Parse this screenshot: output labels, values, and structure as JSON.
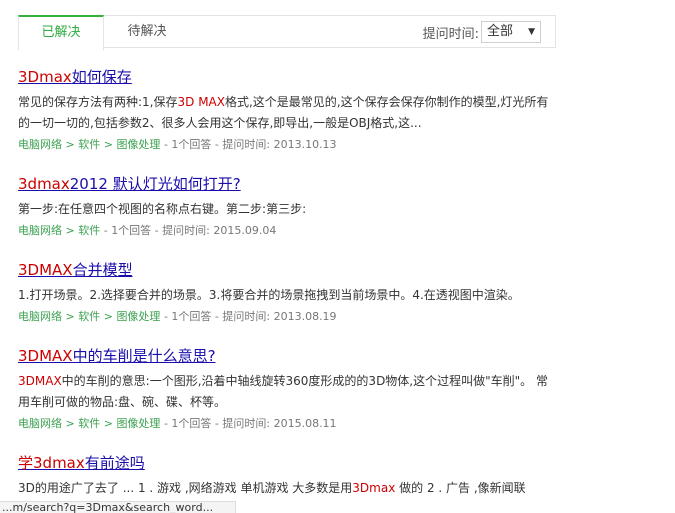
{
  "tabs": {
    "solved": "已解决",
    "pending": "待解决"
  },
  "time_filter": {
    "label": "提问时间:",
    "selected": "全部"
  },
  "results": [
    {
      "title_hl": "3Dmax",
      "title_rest": "如何保存",
      "snippet_pre": "常见的保存方法有两种:1,保存",
      "snippet_hl": "3D MAX",
      "snippet_post": "格式,这个是最常见的,这个保存会保存你制作的模型,灯光所有的一切一切的,包括参数2、很多人会用这个保存,即导出,一般是OBJ格式,这...",
      "cat1": "电脑网络",
      "cat2": "软件",
      "cat3": "图像处理",
      "answers": "1个回答",
      "time": "提问时间: 2013.10.13"
    },
    {
      "title_hl": "3dmax",
      "title_rest": "2012 默认灯光如何打开?",
      "snippet_pre": "第一步:在任意四个视图的名称点右键。第二步:第三步:",
      "snippet_hl": "",
      "snippet_post": "",
      "cat1": "电脑网络",
      "cat2": "软件",
      "cat3": "",
      "answers": "1个回答",
      "time": "提问时间: 2015.09.04"
    },
    {
      "title_hl": "3DMAX",
      "title_rest": "合并模型",
      "snippet_pre": "1.打开场景。2.选择要合并的场景。3.将要合并的场景拖拽到当前场景中。4.在透视图中渲染。",
      "snippet_hl": "",
      "snippet_post": "",
      "cat1": "电脑网络",
      "cat2": "软件",
      "cat3": "图像处理",
      "answers": "1个回答",
      "time": "提问时间: 2013.08.19"
    },
    {
      "title_hl": "3DMAX",
      "title_rest": "中的车削是什么意思?",
      "snippet_pre": "",
      "snippet_hl": "3DMAX",
      "snippet_post": "中的车削的意思:一个图形,沿着中轴线旋转360度形成的的3D物体,这个过程叫做\"车削\"。 常用车削可做的物品:盘、碗、碟、杯等。",
      "cat1": "电脑网络",
      "cat2": "软件",
      "cat3": "图像处理",
      "answers": "1个回答",
      "time": "提问时间: 2015.08.11"
    },
    {
      "title_hl": "学3dmax",
      "title_rest": "有前途吗",
      "snippet_pre": "3D的用途广了去了 ... 1 . 游戏 ,网络游戏 单机游戏 大多数是用",
      "snippet_hl": "3Dmax",
      "snippet_post": " 做的 2 . 广告 ,像新闻联",
      "cat1": "",
      "cat2": "",
      "cat3": "",
      "answers": "",
      "time": ""
    }
  ],
  "status_url": "...m/search?q=3Dmax&search_word..."
}
